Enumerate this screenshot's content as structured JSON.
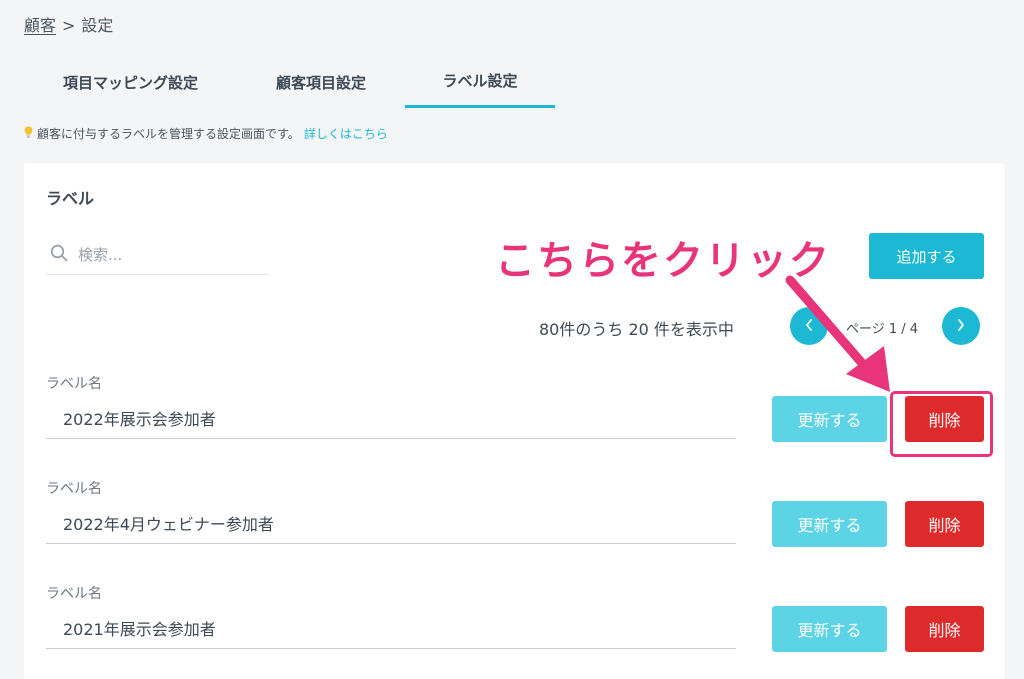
{
  "breadcrumb": {
    "parent": "顧客",
    "separator": ">",
    "current": "設定"
  },
  "tabs": [
    {
      "label": "項目マッピング設定"
    },
    {
      "label": "顧客項目設定"
    },
    {
      "label": "ラベル設定",
      "active": true
    }
  ],
  "hint": {
    "text": "顧客に付与するラベルを管理する設定画面です。",
    "link": "詳しくはこちら"
  },
  "card": {
    "title": "ラベル",
    "search_placeholder": "検索...",
    "add_label": "追加する",
    "count_text": "80件のうち 20 件を表示中",
    "page_text": "ページ 1 / 4",
    "rows": [
      {
        "field_label": "ラベル名",
        "value": "2022年展示会参加者",
        "update_label": "更新する",
        "delete_label": "削除"
      },
      {
        "field_label": "ラベル名",
        "value": "2022年4月ウェビナー参加者",
        "update_label": "更新する",
        "delete_label": "削除"
      },
      {
        "field_label": "ラベル名",
        "value": "2021年展示会参加者",
        "update_label": "更新する",
        "delete_label": "削除"
      }
    ]
  },
  "annotation": {
    "callout_text": "こちらをクリック"
  },
  "colors": {
    "accent": "#1cb8d4",
    "update": "#5dd3e6",
    "delete": "#dd2b2b",
    "annotation": "#e8347a"
  }
}
